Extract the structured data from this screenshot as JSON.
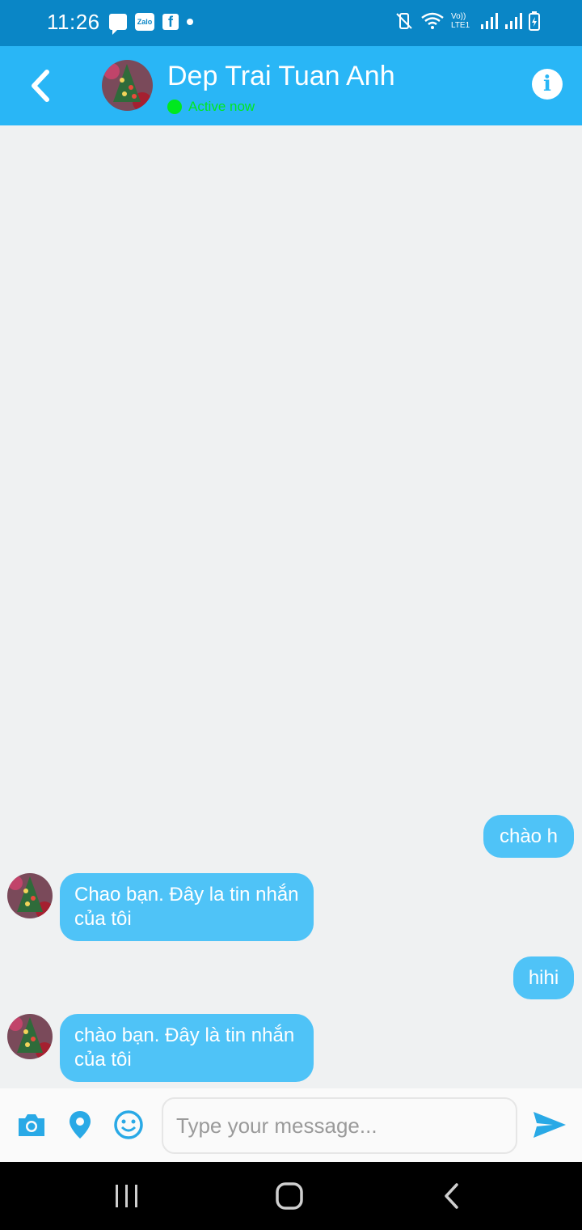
{
  "status_bar": {
    "time": "11:26",
    "left_icons": [
      "message-icon",
      "zalo-icon",
      "facebook-icon",
      "dot-icon"
    ],
    "right_icons": [
      "vibrate-icon",
      "wifi-icon",
      "volte-lte-icon",
      "signal-icon",
      "signal-icon",
      "battery-charging-icon"
    ],
    "zalo_label": "Zalo",
    "fb_label": "f",
    "volte_label": "Vo)) LTE1"
  },
  "header": {
    "back_icon": "chevron-left-icon",
    "title": "Dep Trai Tuan Anh",
    "status": "Active now",
    "status_color": "#00e81e",
    "info_icon": "info-icon",
    "info_glyph": "i",
    "background": "#29b6f6"
  },
  "messages": [
    {
      "direction": "outgoing",
      "text": "chào h"
    },
    {
      "direction": "incoming",
      "text": "Chao bạn. Đây la tin nhắn của tôi"
    },
    {
      "direction": "outgoing",
      "text": "hihi"
    },
    {
      "direction": "incoming",
      "text": "chào bạn. Đây là tin nhắn của tôi"
    }
  ],
  "composer": {
    "placeholder": "Type your message...",
    "icons": [
      "camera-icon",
      "location-icon",
      "emoji-icon",
      "send-icon"
    ]
  },
  "colors": {
    "bubble": "#4fc3f7",
    "status_bar": "#0a86c6",
    "chat_background": "#eff1f2"
  }
}
